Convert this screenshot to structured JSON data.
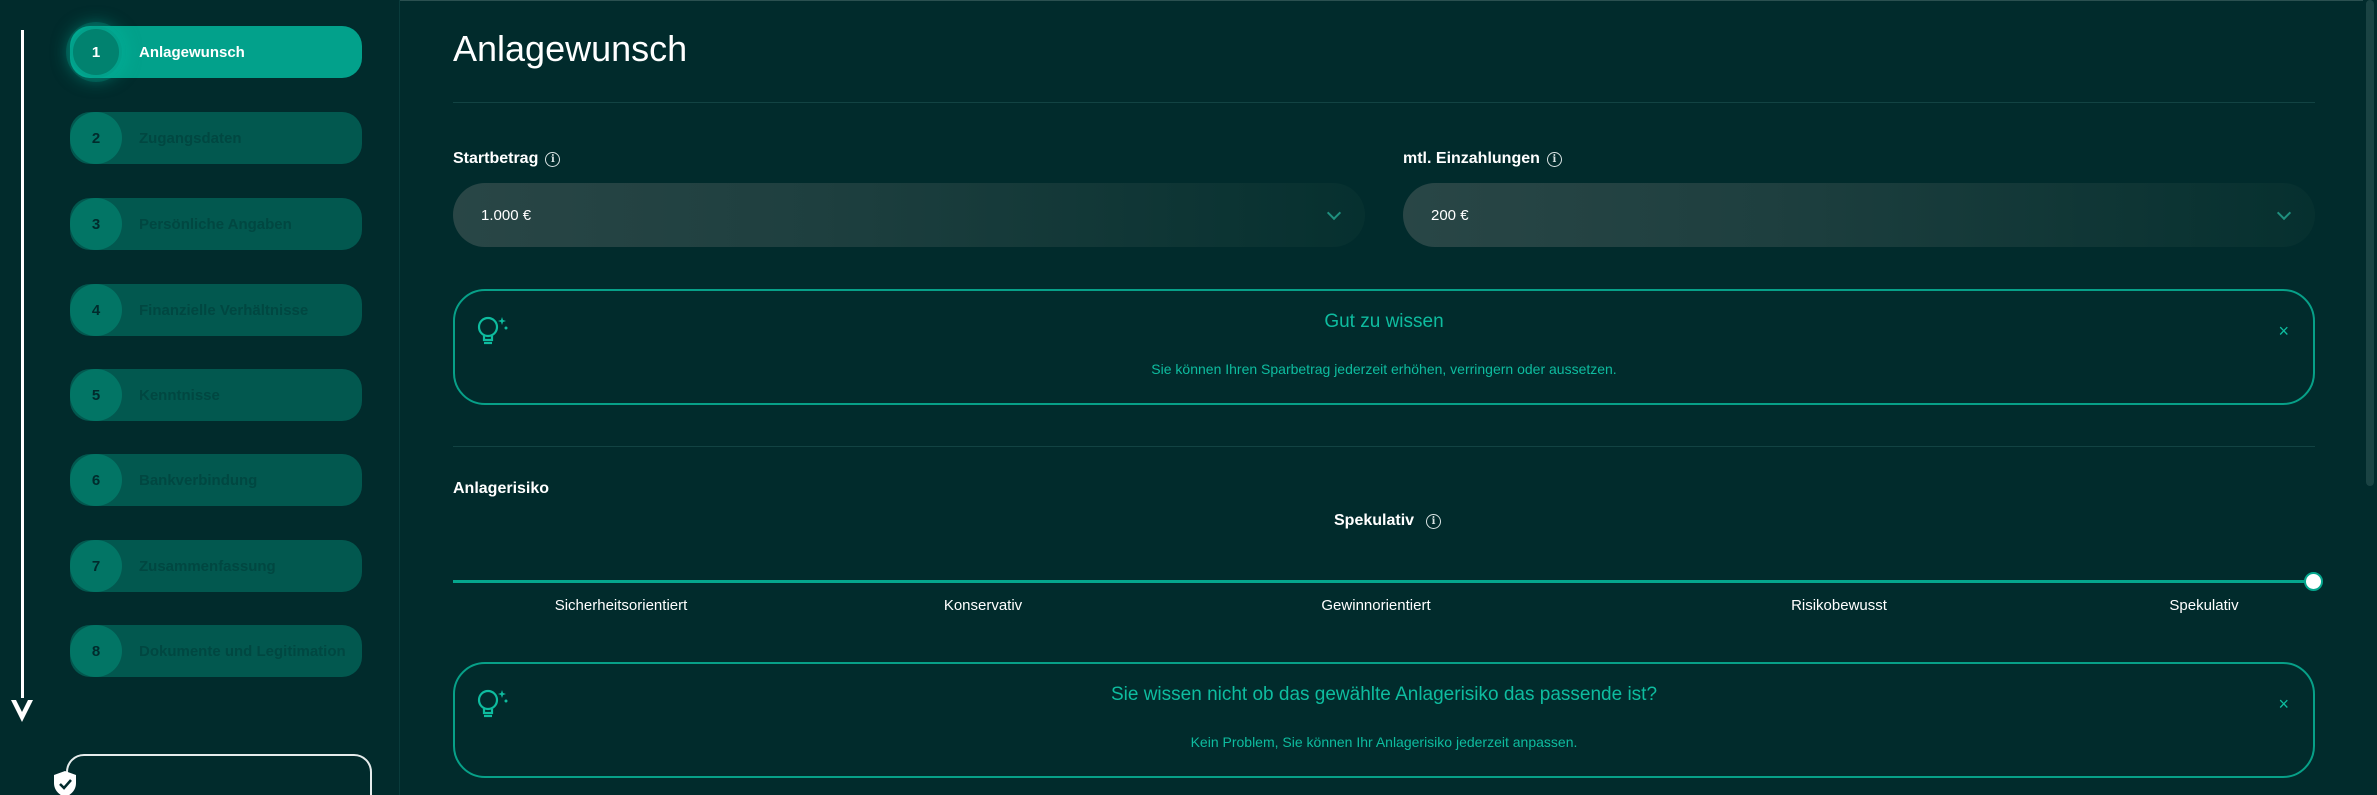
{
  "sidebar": {
    "steps": [
      {
        "number": "1",
        "label": "Anlagewunsch"
      },
      {
        "number": "2",
        "label": "Zugangsdaten"
      },
      {
        "number": "3",
        "label": "Persönliche Angaben"
      },
      {
        "number": "4",
        "label": "Finanzielle Verhältnisse"
      },
      {
        "number": "5",
        "label": "Kenntnisse"
      },
      {
        "number": "6",
        "label": "Bankverbindung"
      },
      {
        "number": "7",
        "label": "Zusammenfassung"
      },
      {
        "number": "8",
        "label": "Dokumente und Legitimation"
      }
    ],
    "active_step": 1
  },
  "main": {
    "title": "Anlagewunsch",
    "start_amount": {
      "label": "Startbetrag",
      "value": "1.000 €"
    },
    "monthly": {
      "label": "mtl. Einzahlungen",
      "value": "200 €"
    },
    "tip1": {
      "title": "Gut zu wissen",
      "text": "Sie können Ihren Sparbetrag jederzeit erhöhen, verringern oder aussetzen.",
      "close": "×"
    },
    "risk": {
      "label": "Anlagerisiko",
      "current": "Spekulativ",
      "options": [
        "Sicherheitsorientiert",
        "Konservativ",
        "Gewinnorientiert",
        "Risikobewusst",
        "Spekulativ"
      ],
      "selected_index": 4
    },
    "tip2": {
      "title": "Sie wissen nicht ob das gewählte Anlagerisiko das passende ist?",
      "text": "Kein Problem, Sie können Ihr Anlagerisiko jederzeit anpassen.",
      "close": "×"
    }
  },
  "colors": {
    "background": "#012b2c",
    "accent": "#02a18b",
    "tip_text": "#0ebc9f"
  }
}
